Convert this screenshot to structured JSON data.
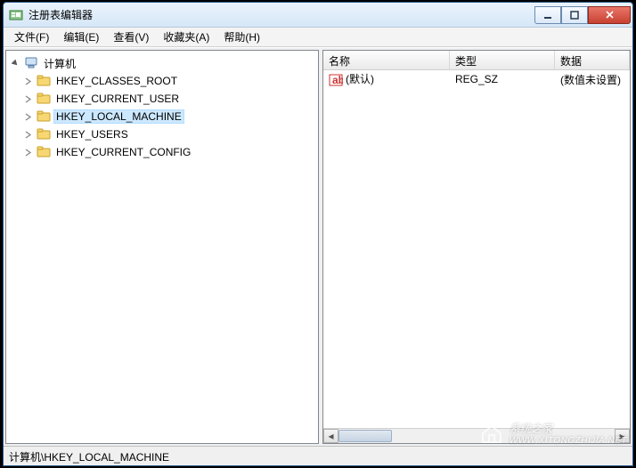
{
  "window": {
    "title": "注册表编辑器"
  },
  "menu": {
    "file": "文件(F)",
    "edit": "编辑(E)",
    "view": "查看(V)",
    "favorites": "收藏夹(A)",
    "help": "帮助(H)"
  },
  "tree": {
    "root": "计算机",
    "items": [
      {
        "label": "HKEY_CLASSES_ROOT",
        "selected": false
      },
      {
        "label": "HKEY_CURRENT_USER",
        "selected": false
      },
      {
        "label": "HKEY_LOCAL_MACHINE",
        "selected": true
      },
      {
        "label": "HKEY_USERS",
        "selected": false
      },
      {
        "label": "HKEY_CURRENT_CONFIG",
        "selected": false
      }
    ]
  },
  "list": {
    "columns": {
      "name": "名称",
      "type": "类型",
      "data": "数据"
    },
    "rows": [
      {
        "name": "(默认)",
        "type": "REG_SZ",
        "data": "(数值未设置)"
      }
    ]
  },
  "statusbar": {
    "path": "计算机\\HKEY_LOCAL_MACHINE"
  },
  "watermark": {
    "brand": "系统之家",
    "url": "WWW.XITONGZHIJIA.NET"
  }
}
